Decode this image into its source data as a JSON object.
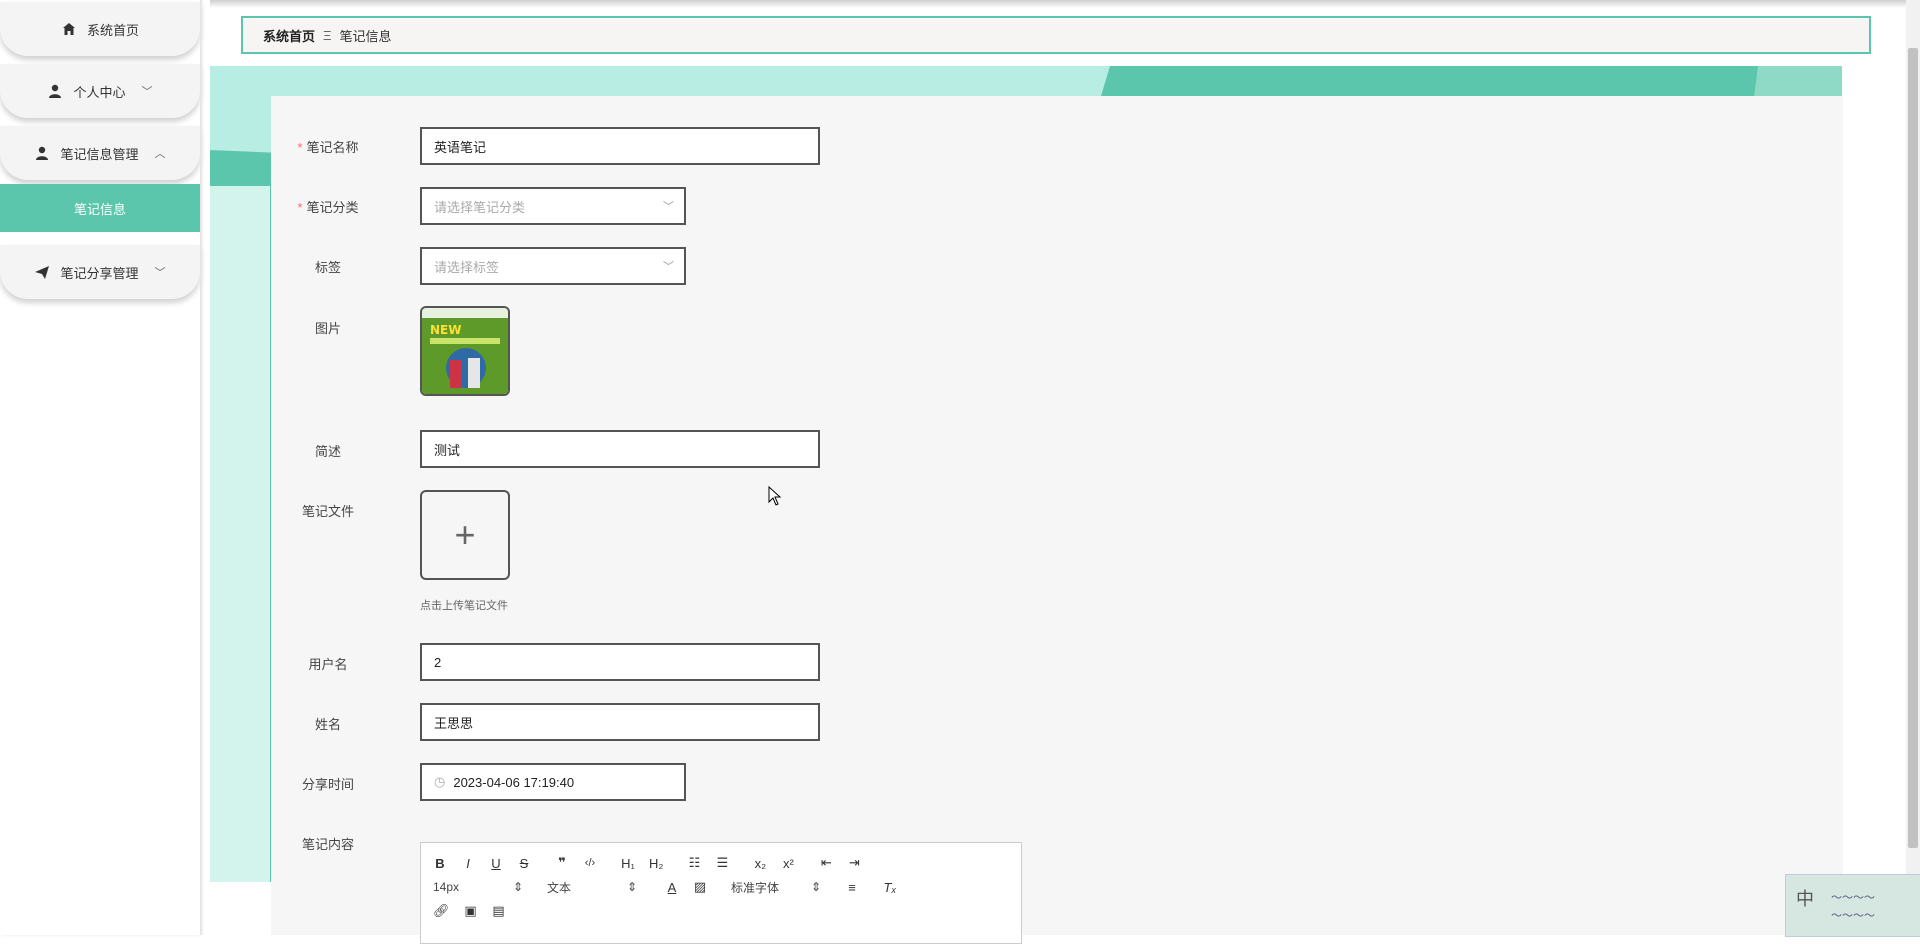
{
  "sidebar": {
    "items": [
      {
        "label": "系统首页",
        "icon": "home-icon"
      },
      {
        "label": "个人中心",
        "icon": "user-icon"
      },
      {
        "label": "笔记信息管理",
        "icon": "user-icon"
      },
      {
        "label": "笔记分享管理",
        "icon": "send-icon"
      }
    ],
    "active_sub": "笔记信息",
    "accent": "#5cc6ad"
  },
  "breadcrumb": {
    "home": "系统首页",
    "separator": "Ξ",
    "current": "笔记信息"
  },
  "form": {
    "name_label": "笔记名称",
    "name_value": "英语笔记",
    "category_label": "笔记分类",
    "category_placeholder": "请选择笔记分类",
    "tag_label": "标签",
    "tag_placeholder": "请选择标签",
    "image_label": "图片",
    "desc_label": "简述",
    "desc_value": "测试",
    "file_label": "笔记文件",
    "file_hint": "点击上传笔记文件",
    "username_label": "用户名",
    "username_value": "2",
    "realname_label": "姓名",
    "realname_value": "王思思",
    "time_label": "分享时间",
    "time_value": "2023-04-06 17:19:40",
    "content_label": "笔记内容"
  },
  "editor": {
    "size_option": "14px",
    "format_option": "文本",
    "font_option": "标准字体"
  },
  "ime": {
    "mode": "中"
  }
}
